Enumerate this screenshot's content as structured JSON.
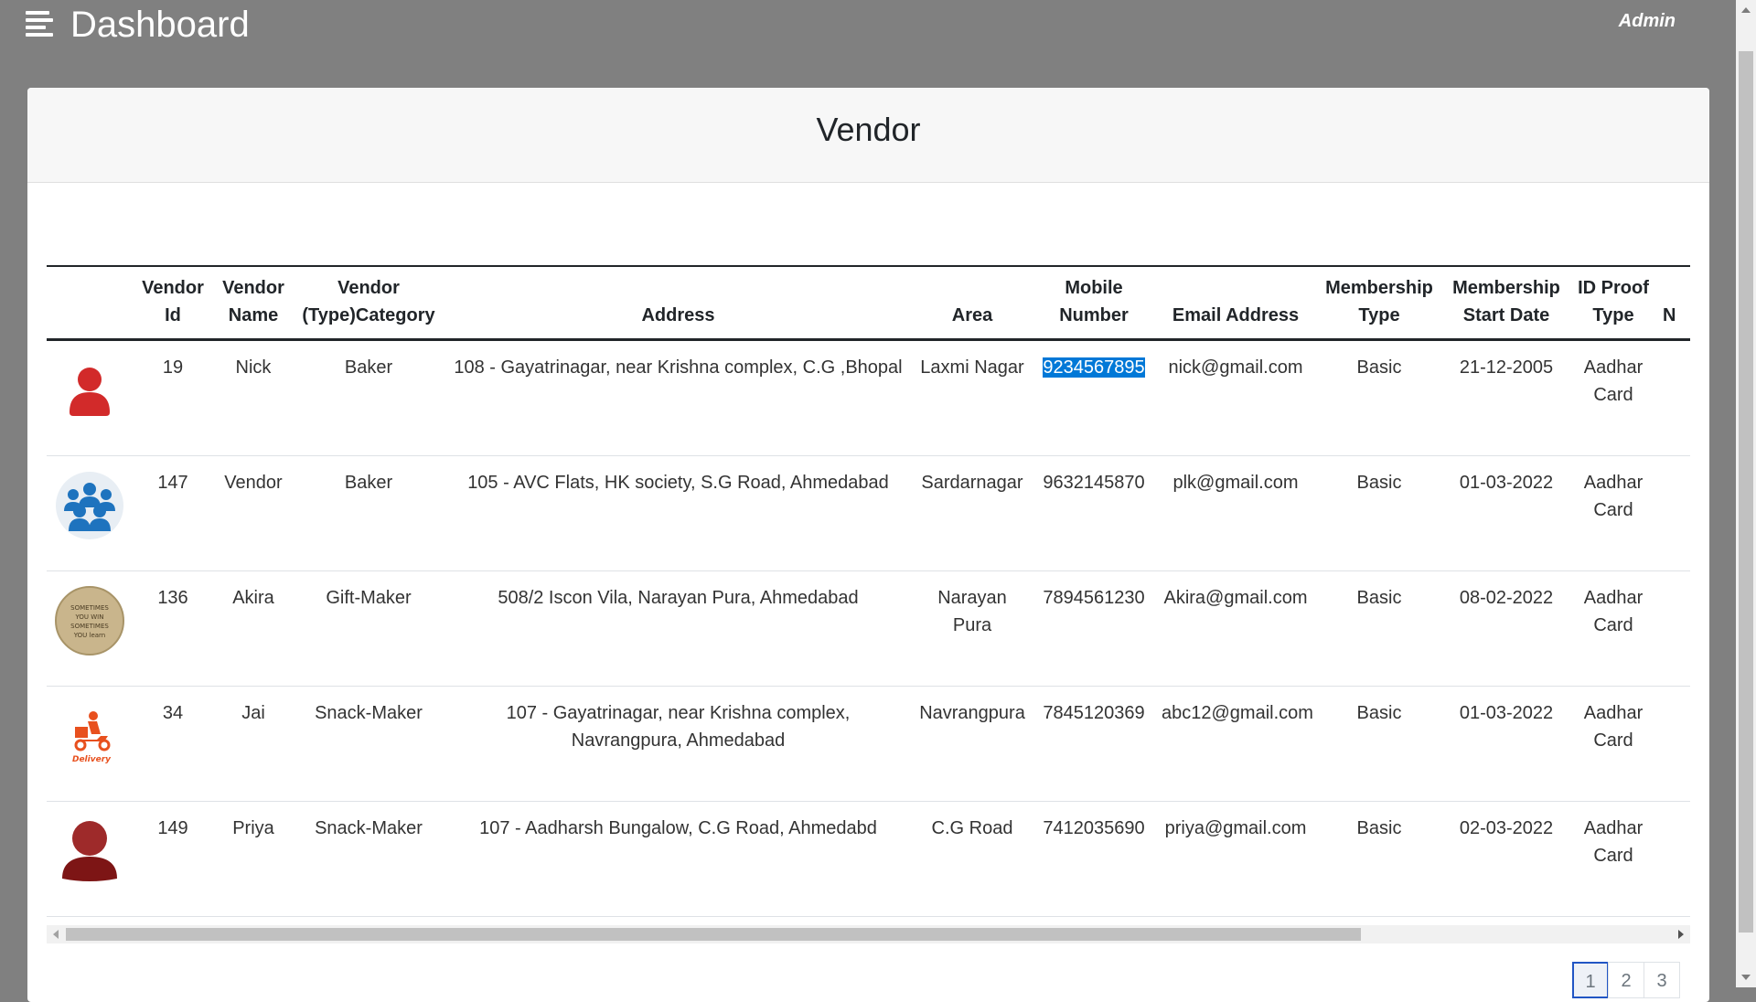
{
  "header": {
    "title": "Dashboard",
    "user": "Admin"
  },
  "card": {
    "title": "Vendor"
  },
  "table": {
    "columns": [
      "",
      "Vendor Id",
      "Vendor Name",
      "Vendor (Type)Category",
      "Address",
      "Area",
      "Mobile Number",
      "Email Address",
      "Membership Type",
      "Membership Start Date",
      "ID Proof Type",
      "N"
    ],
    "rows": [
      {
        "image": "person-red-icon",
        "id": "19",
        "name": "Nick",
        "category": "Baker",
        "address": "108 - Gayatrinagar, near Krishna complex, C.G ,Bhopal",
        "area": "Laxmi Nagar",
        "mobile": "9234567895",
        "email": "nick@gmail.com",
        "membership_type": "Basic",
        "start_date": "21-12-2005",
        "id_proof": "Aadhar Card"
      },
      {
        "image": "group-blue-icon",
        "id": "147",
        "name": "Vendor",
        "category": "Baker",
        "address": "105 - AVC Flats, HK society, S.G Road, Ahmedabad",
        "area": "Sardarnagar",
        "mobile": "9632145870",
        "email": "plk@gmail.com",
        "membership_type": "Basic",
        "start_date": "01-03-2022",
        "id_proof": "Aadhar Card"
      },
      {
        "image": "quote-badge-image",
        "image_text": [
          "SOMETIMES",
          "YOU WIN",
          "SOMETIMES",
          "YOU learn"
        ],
        "id": "136",
        "name": "Akira",
        "category": "Gift-Maker",
        "address": "508/2 Iscon Vila, Narayan Pura, Ahmedabad",
        "area": "Narayan Pura",
        "mobile": "7894561230",
        "email": "Akira@gmail.com",
        "membership_type": "Basic",
        "start_date": "08-02-2022",
        "id_proof": "Aadhar Card"
      },
      {
        "image": "delivery-scooter-icon",
        "image_text": [
          "Delivery"
        ],
        "id": "34",
        "name": "Jai",
        "category": "Snack-Maker",
        "address": "107 - Gayatrinagar, near Krishna complex, Navrangpura, Ahmedabad",
        "area": "Navrangpura",
        "mobile": "7845120369",
        "email": "abc12@gmail.com",
        "membership_type": "Basic",
        "start_date": "01-03-2022",
        "id_proof": "Aadhar Card"
      },
      {
        "image": "person-maroon-icon",
        "id": "149",
        "name": "Priya",
        "category": "Snack-Maker",
        "address": "107 - Aadharsh Bungalow, C.G Road, Ahmedabd",
        "area": "C.G Road",
        "mobile": "7412035690",
        "email": "priya@gmail.com",
        "membership_type": "Basic",
        "start_date": "02-03-2022",
        "id_proof": "Aadhar Card"
      }
    ]
  },
  "pagination": {
    "pages": [
      "1",
      "2",
      "3"
    ],
    "active_page": "1"
  },
  "colors": {
    "backdrop": "#808080",
    "selection": "#0078d7",
    "active_page_border": "#2155c4"
  }
}
